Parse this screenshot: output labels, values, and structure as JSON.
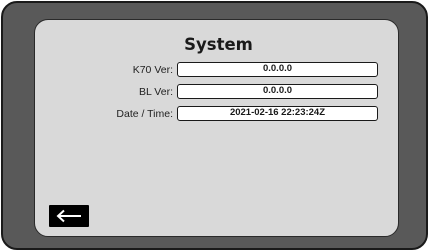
{
  "screen": {
    "title": "System",
    "rows": [
      {
        "label": "K70 Ver:",
        "value": "0.0.0.0"
      },
      {
        "label": "BL Ver:",
        "value": "0.0.0.0"
      },
      {
        "label": "Date / Time:",
        "value": "2021-02-16 22:23:24Z"
      }
    ]
  },
  "controls": {
    "back_icon": "arrow-left-icon"
  },
  "colors": {
    "bezel": "#595959",
    "screen_bg": "#d9d9d9",
    "value_box_bg": "#ffffff",
    "button_bg": "#000000"
  }
}
